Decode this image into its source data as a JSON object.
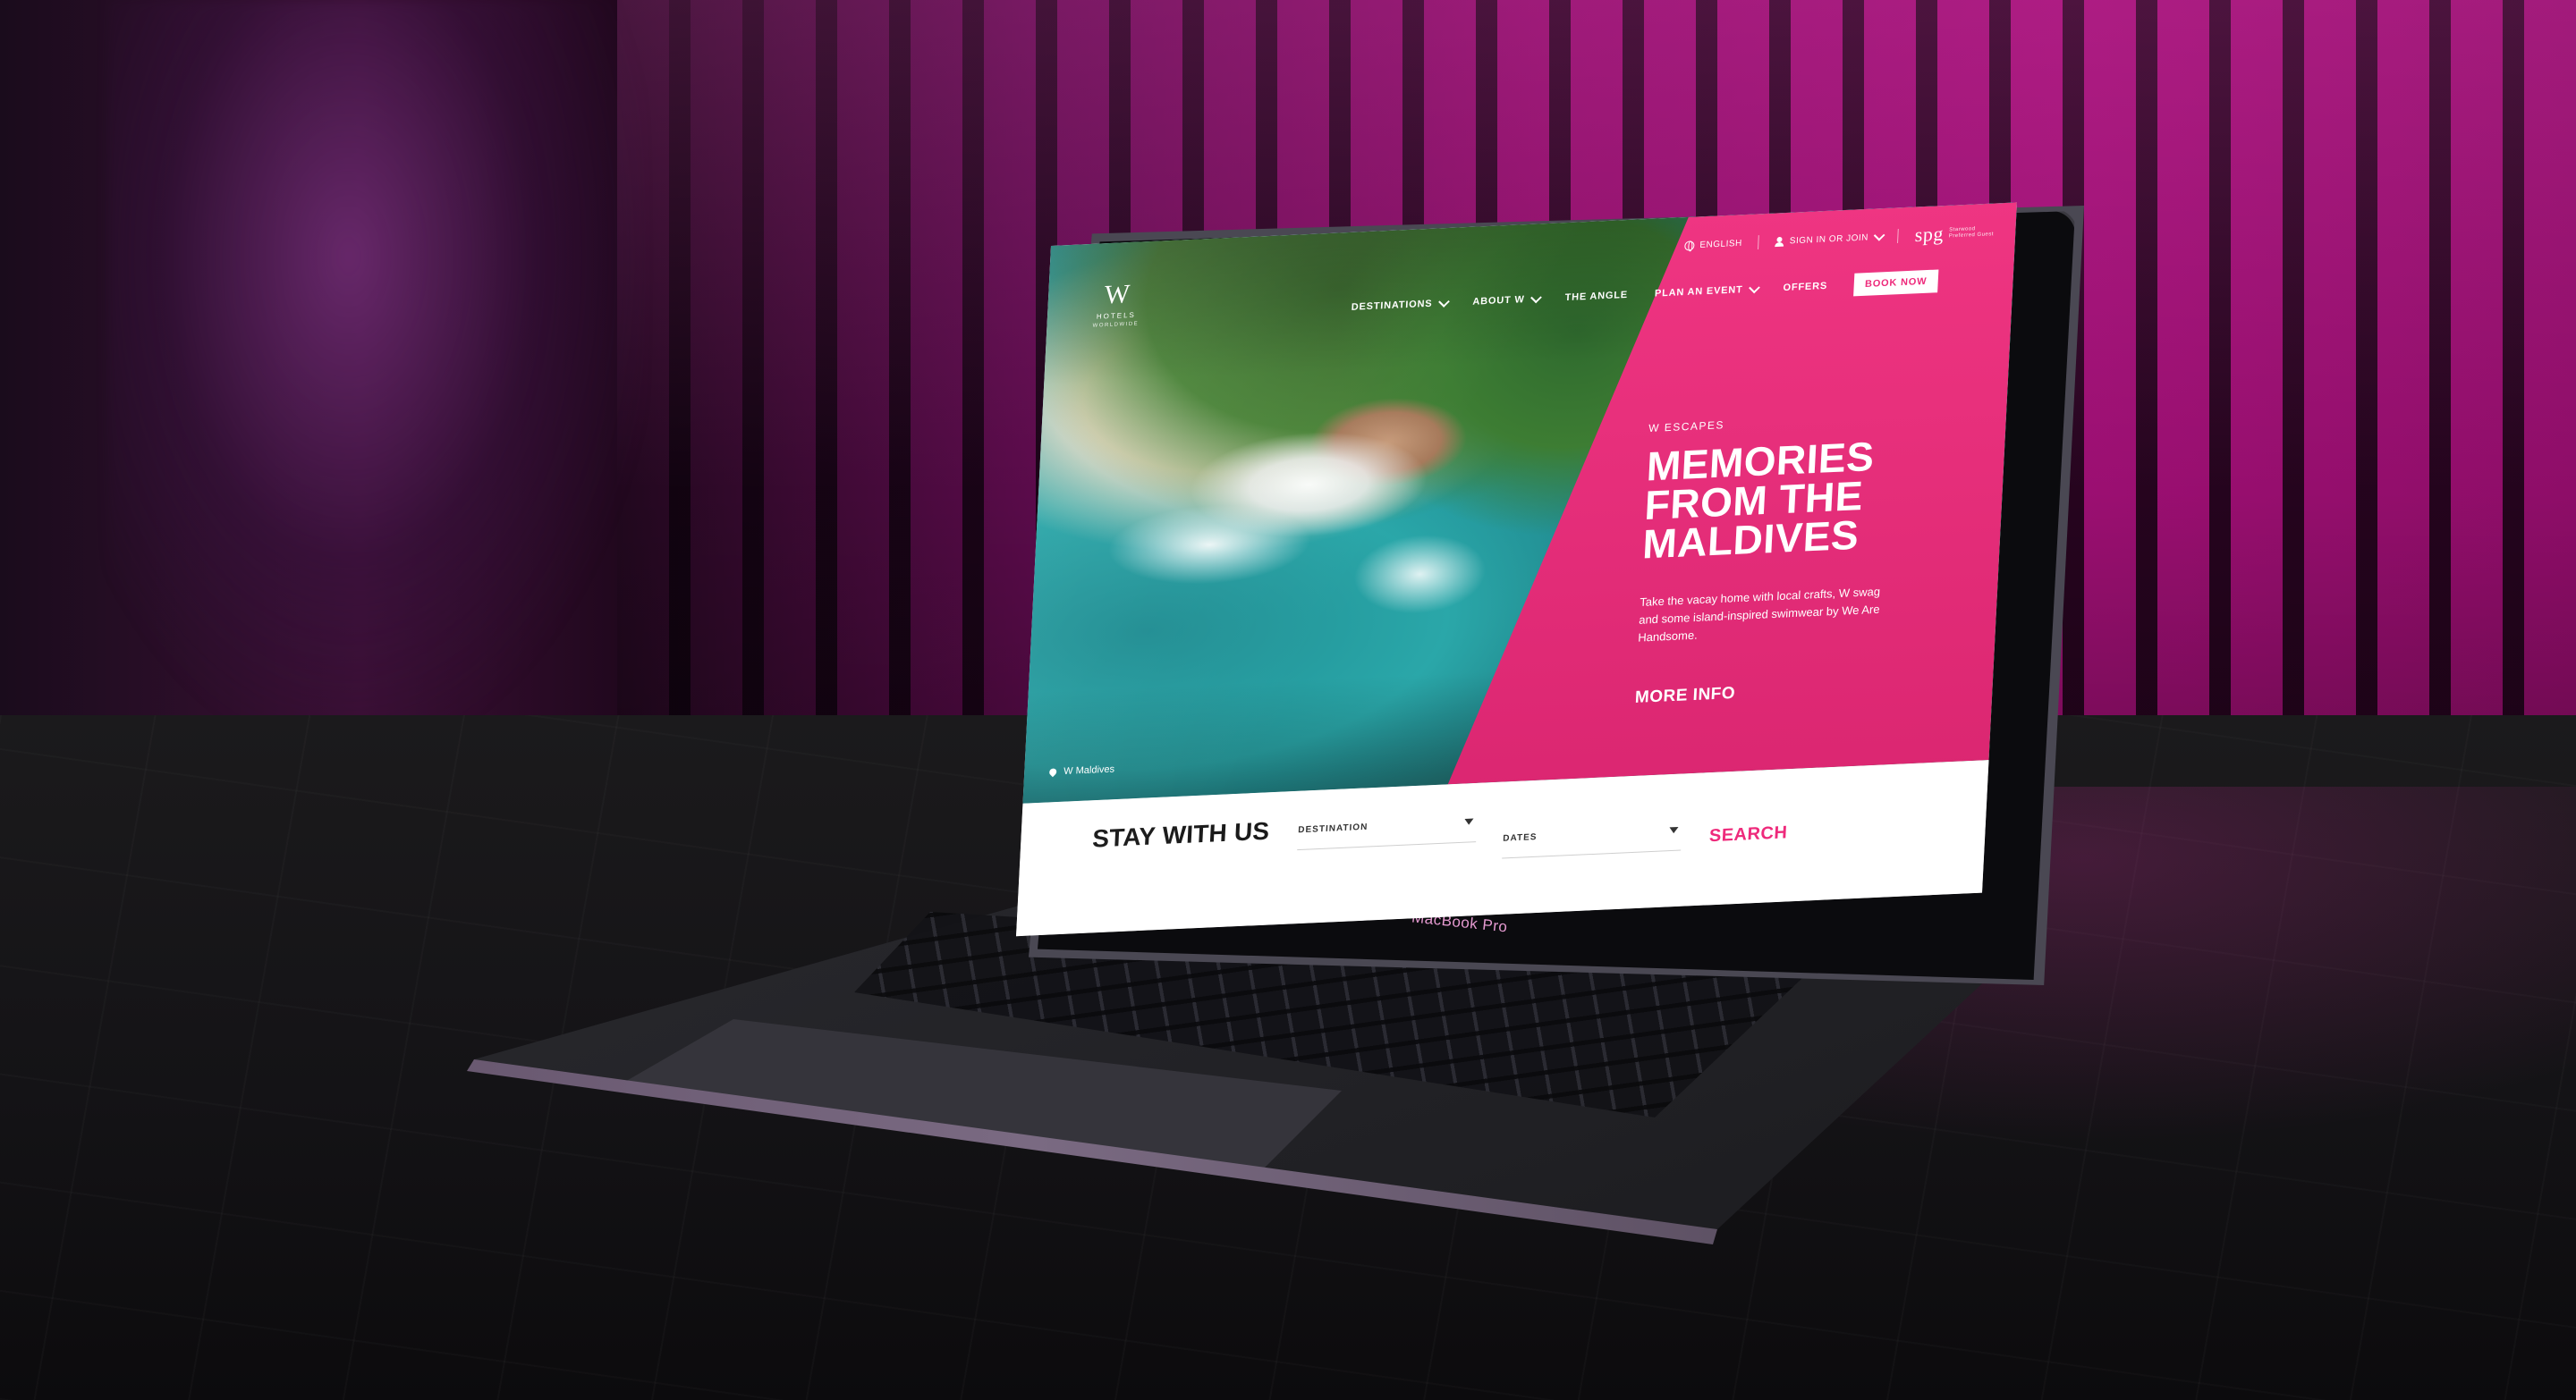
{
  "device": {
    "label": "MacBook Pro"
  },
  "header": {
    "logo": {
      "mark": "W",
      "line1": "HOTELS",
      "line2": "WORLDWIDE"
    },
    "utility": {
      "language": "ENGLISH",
      "signin": "SIGN IN OR JOIN",
      "partner_logo": "spg",
      "partner_sub": "Starwood Preferred Guest"
    },
    "nav": [
      {
        "label": "DESTINATIONS"
      },
      {
        "label": "ABOUT W"
      },
      {
        "label": "THE ANGLE"
      },
      {
        "label": "PLAN AN EVENT"
      },
      {
        "label": "OFFERS"
      }
    ],
    "book_now": "BOOK NOW"
  },
  "hero": {
    "eyebrow": "W ESCAPES",
    "title": "MEMORIES\nFROM THE\nMALDIVES",
    "text": "Take the vacay home with local crafts, W swag and some island-inspired swimwear by We Are Handsome.",
    "cta": "MORE INFO",
    "location": "W Maldives"
  },
  "booking": {
    "heading": "STAY WITH US",
    "destination_label": "DESTINATION",
    "dates_label": "DATES",
    "search": "SEARCH"
  },
  "colors": {
    "brand_pink": "#ee2a7b",
    "white": "#ffffff"
  }
}
